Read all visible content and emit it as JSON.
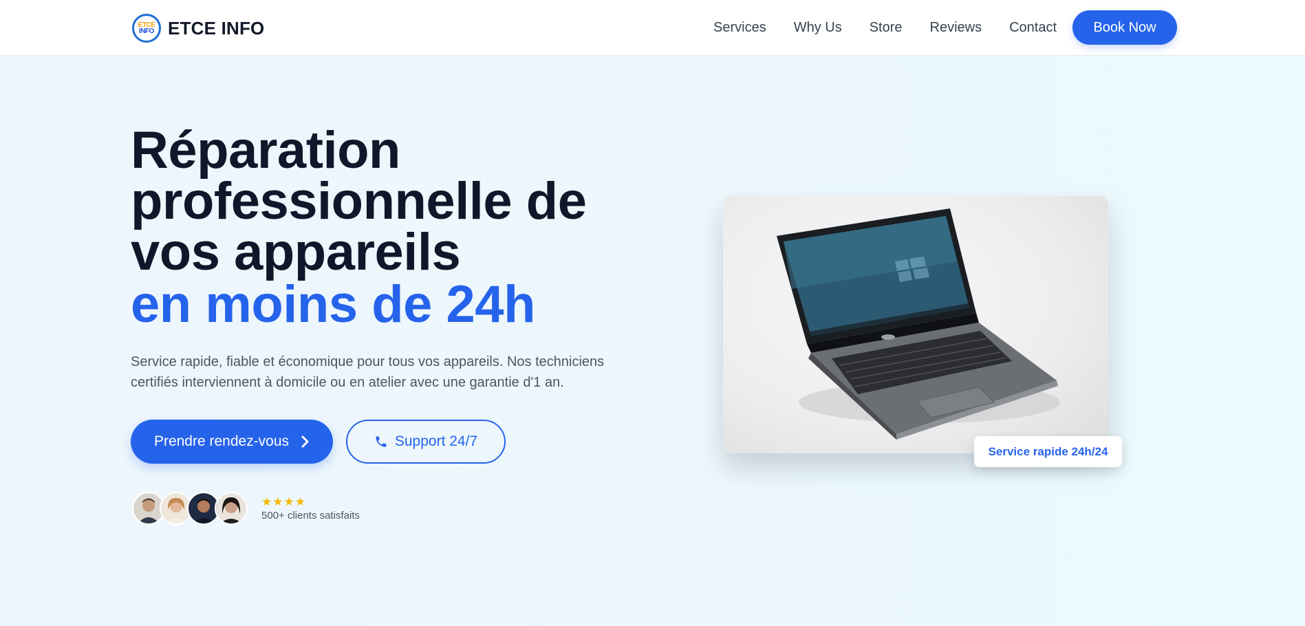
{
  "header": {
    "brand": {
      "logo_line1": "ETCE",
      "logo_line2": "INFO",
      "name": "ETCE INFO"
    },
    "nav": [
      {
        "label": "Services"
      },
      {
        "label": "Why Us"
      },
      {
        "label": "Store"
      },
      {
        "label": "Reviews"
      },
      {
        "label": "Contact"
      }
    ],
    "cta_label": "Book Now"
  },
  "hero": {
    "title_lines": [
      "Réparation",
      "professionnelle de",
      "vos appareils"
    ],
    "title_accent": "en moins de 24h",
    "description": "Service rapide, fiable et économique pour tous vos appareils. Nos techniciens certifiés interviennent à domicile ou en atelier avec une garantie d'1 an.",
    "primary_button": "Prendre rendez-vous",
    "secondary_button": "Support 24/7",
    "social_proof": {
      "rating_stars": 4,
      "text": "500+ clients satisfaits"
    },
    "image_badge": "Service rapide 24h/24"
  },
  "colors": {
    "accent": "#2563eb",
    "heading": "#0f172a",
    "star": "#f5b800"
  },
  "icons": [
    "chevron-right-icon",
    "phone-icon",
    "star-icon"
  ]
}
